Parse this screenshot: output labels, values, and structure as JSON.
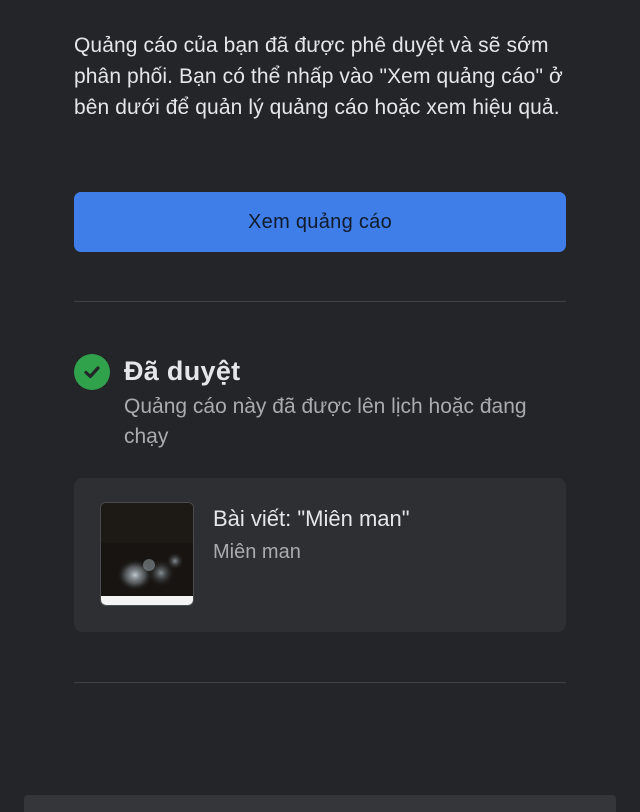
{
  "message": {
    "text": "Quảng cáo của bạn đã được phê duyệt và sẽ sớm phân phối. Bạn có thể nhấp vào \"Xem quảng cáo\" ở bên dưới để quản lý quảng cáo hoặc xem hiệu quả."
  },
  "actions": {
    "view_ad_label": "Xem quảng cáo"
  },
  "status": {
    "title": "Đã duyệt",
    "description": "Quảng cáo này đã được lên lịch hoặc đang chạy",
    "icon": "check-circle-icon",
    "color": "#31a24c"
  },
  "post": {
    "title": "Bài viết: \"Miên man\"",
    "subtitle": "Miên man"
  },
  "colors": {
    "background": "#242528",
    "accent": "#3f7ee8",
    "card": "#2e2f33",
    "divider": "#3e4042"
  }
}
